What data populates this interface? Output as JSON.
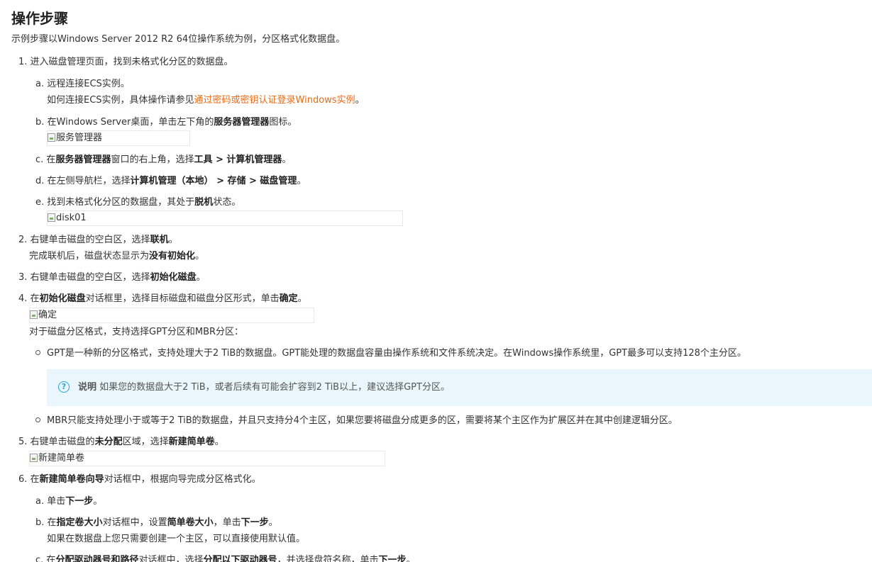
{
  "title": "操作步骤",
  "intro": "示例步骤以Windows Server 2012 R2 64位操作系统为例，分区格式化数据盘。",
  "step1": {
    "num": "1.",
    "text": "进入磁盘管理页面，找到未格式化分区的数据盘。",
    "a": {
      "num": "a.",
      "text": "远程连接ECS实例。",
      "sub_prefix": "如何连接ECS实例，具体操作请参见",
      "sub_link": "通过密码或密钥认证登录Windows实例",
      "sub_suffix": "。"
    },
    "b": {
      "num": "b.",
      "pre": "在Windows Server桌面，单击左下角的",
      "bold": "服务器管理器",
      "post": "图标。",
      "img_alt": "服务管理器"
    },
    "c": {
      "num": "c.",
      "pre": "在",
      "bold1": "服务器管理器",
      "mid": "窗口的右上角，选择",
      "bold2": "工具 > 计算机管理器",
      "post": "。"
    },
    "d": {
      "num": "d.",
      "pre": "在左侧导航栏，选择",
      "bold": "计算机管理（本地） > 存储 > 磁盘管理",
      "post": "。"
    },
    "e": {
      "num": "e.",
      "pre": "找到未格式化分区的数据盘，其处于",
      "bold": "脱机",
      "post": "状态。",
      "img_alt": "disk01"
    }
  },
  "step2": {
    "num": "2.",
    "pre": "右键单击磁盘的空白区，选择",
    "bold": "联机",
    "post": "。",
    "sub_pre": "完成联机后，磁盘状态显示为",
    "sub_bold": "没有初始化",
    "sub_post": "。"
  },
  "step3": {
    "num": "3.",
    "pre": "右键单击磁盘的空白区，选择",
    "bold": "初始化磁盘",
    "post": "。"
  },
  "step4": {
    "num": "4.",
    "pre": "在",
    "bold1": "初始化磁盘",
    "mid": "对话框里，选择目标磁盘和磁盘分区形式，单击",
    "bold2": "确定",
    "post": "。",
    "img_alt": "确定",
    "formats_intro": "对于磁盘分区格式，支持选择GPT分区和MBR分区：",
    "gpt": "GPT是一种新的分区格式，支持处理大于2 TiB的数据盘。GPT能处理的数据盘容量由操作系统和文件系统决定。在Windows操作系统里，GPT最多可以支持128个主分区。",
    "note_label": "说明",
    "note_text": "如果您的数据盘大于2 TiB，或者后续有可能会扩容到2 TiB以上，建议选择GPT分区。",
    "mbr": "MBR只能支持处理小于或等于2 TiB的数据盘，并且只支持分4个主区，如果您要将磁盘分成更多的区，需要将某个主区作为扩展区并在其中创建逻辑分区。"
  },
  "step5": {
    "num": "5.",
    "pre": "右键单击磁盘的",
    "bold1": "未分配",
    "mid": "区域，选择",
    "bold2": "新建简单卷",
    "post": "。",
    "img_alt": "新建简单卷"
  },
  "step6": {
    "num": "6.",
    "pre": "在",
    "bold": "新建简单卷向导",
    "post": "对话框中，根据向导完成分区格式化。",
    "a": {
      "num": "a.",
      "pre": "单击",
      "bold": "下一步",
      "post": "。"
    },
    "b": {
      "num": "b.",
      "pre": "在",
      "bold1": "指定卷大小",
      "mid1": "对话框中，设置",
      "bold2": "简单卷大小",
      "mid2": "，单击",
      "bold3": "下一步",
      "post": "。",
      "sub": "如果在数据盘上您只需要创建一个主区，可以直接使用默认值。"
    },
    "c": {
      "num": "c.",
      "pre": "在",
      "bold1": "分配驱动器号和路径",
      "mid1": "对话框中，选择",
      "bold2": "分配以下驱动器号",
      "mid2": "，并选择盘符名称，单击",
      "bold3": "下一步",
      "post": "。"
    }
  },
  "colors": {
    "link": "#e96a13",
    "note_bg": "#e9f6fc",
    "note_icon": "#27a4dc"
  },
  "icons": {
    "note": "question-circle-icon",
    "broken_image": "broken-image-icon"
  }
}
